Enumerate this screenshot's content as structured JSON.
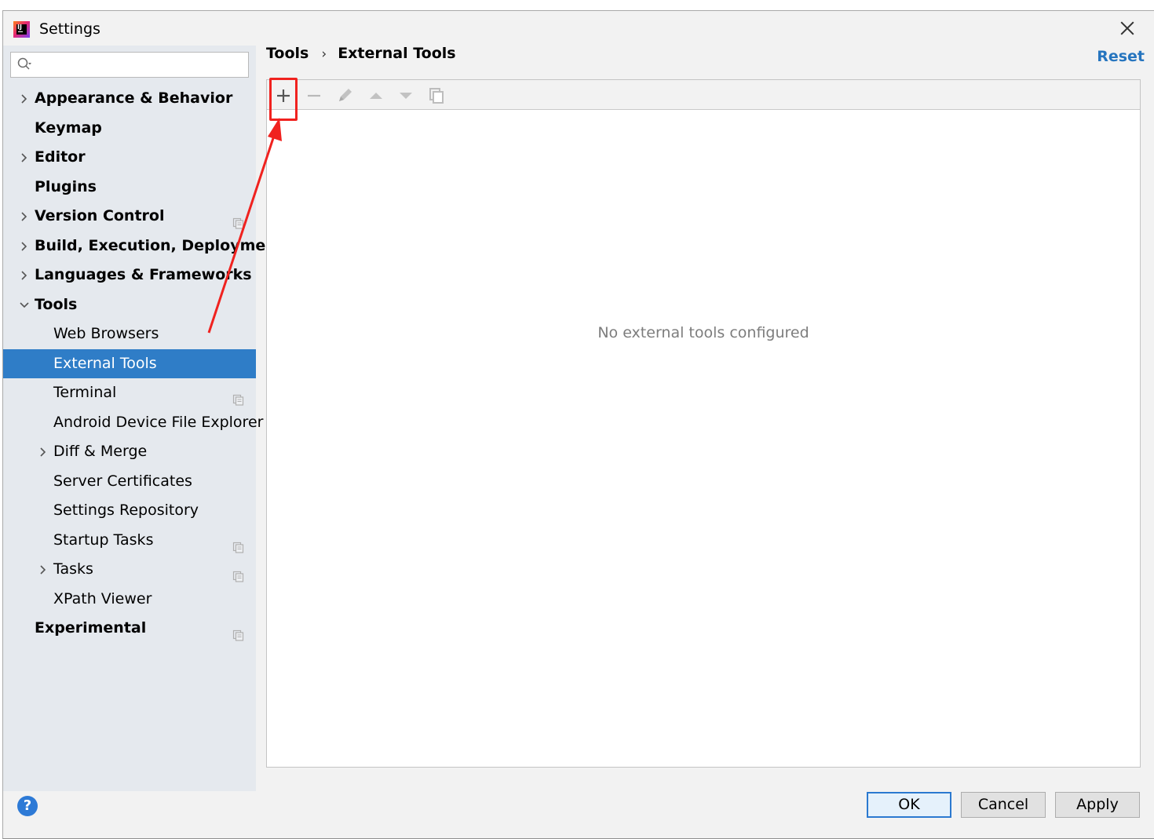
{
  "window": {
    "title": "Settings",
    "app_icon_text": "IJ"
  },
  "search": {
    "value": "",
    "placeholder": ""
  },
  "tree": [
    {
      "label": "Appearance & Behavior",
      "level": 0,
      "expandable": true,
      "expanded": false,
      "project_icon": false,
      "selected": false
    },
    {
      "label": "Keymap",
      "level": 0,
      "expandable": false,
      "expanded": false,
      "project_icon": false,
      "selected": false
    },
    {
      "label": "Editor",
      "level": 0,
      "expandable": true,
      "expanded": false,
      "project_icon": false,
      "selected": false
    },
    {
      "label": "Plugins",
      "level": 0,
      "expandable": false,
      "expanded": false,
      "project_icon": false,
      "selected": false
    },
    {
      "label": "Version Control",
      "level": 0,
      "expandable": true,
      "expanded": false,
      "project_icon": true,
      "selected": false
    },
    {
      "label": "Build, Execution, Deployment",
      "level": 0,
      "expandable": true,
      "expanded": false,
      "project_icon": false,
      "selected": false
    },
    {
      "label": "Languages & Frameworks",
      "level": 0,
      "expandable": true,
      "expanded": false,
      "project_icon": false,
      "selected": false
    },
    {
      "label": "Tools",
      "level": 0,
      "expandable": true,
      "expanded": true,
      "project_icon": false,
      "selected": false
    },
    {
      "label": "Web Browsers",
      "level": 1,
      "expandable": false,
      "expanded": false,
      "project_icon": false,
      "selected": false
    },
    {
      "label": "External Tools",
      "level": 1,
      "expandable": false,
      "expanded": false,
      "project_icon": false,
      "selected": true
    },
    {
      "label": "Terminal",
      "level": 1,
      "expandable": false,
      "expanded": false,
      "project_icon": true,
      "selected": false
    },
    {
      "label": "Android Device File Explorer",
      "level": 1,
      "expandable": false,
      "expanded": false,
      "project_icon": false,
      "selected": false
    },
    {
      "label": "Diff & Merge",
      "level": 1,
      "expandable": true,
      "expanded": false,
      "project_icon": false,
      "selected": false
    },
    {
      "label": "Server Certificates",
      "level": 1,
      "expandable": false,
      "expanded": false,
      "project_icon": false,
      "selected": false
    },
    {
      "label": "Settings Repository",
      "level": 1,
      "expandable": false,
      "expanded": false,
      "project_icon": false,
      "selected": false
    },
    {
      "label": "Startup Tasks",
      "level": 1,
      "expandable": false,
      "expanded": false,
      "project_icon": true,
      "selected": false
    },
    {
      "label": "Tasks",
      "level": 1,
      "expandable": true,
      "expanded": false,
      "project_icon": true,
      "selected": false
    },
    {
      "label": "XPath Viewer",
      "level": 1,
      "expandable": false,
      "expanded": false,
      "project_icon": false,
      "selected": false
    },
    {
      "label": "Experimental",
      "level": 0,
      "expandable": false,
      "expanded": false,
      "project_icon": true,
      "selected": false
    }
  ],
  "breadcrumb": {
    "parent": "Tools",
    "separator": "›",
    "current": "External Tools"
  },
  "reset_label": "Reset",
  "toolbar": {
    "buttons": [
      "plus-icon",
      "minus-icon",
      "pencil-icon",
      "arrow-up-icon",
      "arrow-down-icon",
      "copy-icon"
    ]
  },
  "tools_list": {
    "empty_text": "No external tools configured"
  },
  "footer": {
    "help_label": "?",
    "ok_label": "OK",
    "cancel_label": "Cancel",
    "apply_label": "Apply"
  },
  "colors": {
    "selection": "#2f7dc7",
    "link": "#2675bf",
    "annotation": "#f0221f",
    "sidebar_bg": "#e5e9ee"
  }
}
